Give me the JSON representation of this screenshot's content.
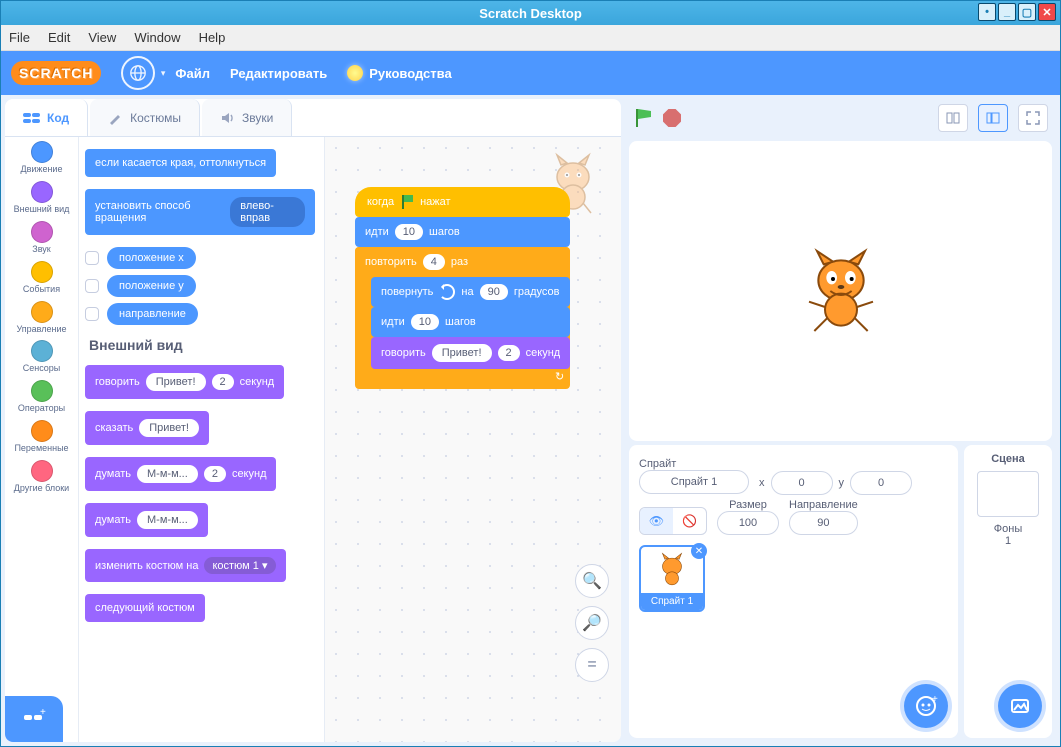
{
  "title": "Scratch Desktop",
  "menu": {
    "file": "File",
    "edit": "Edit",
    "view": "View",
    "window": "Window",
    "help": "Help"
  },
  "topbar": {
    "logo": "SCRATCH",
    "file": "Файл",
    "edit": "Редактировать",
    "tutorials": "Руководства"
  },
  "tabs": {
    "code": "Код",
    "costumes": "Костюмы",
    "sounds": "Звуки"
  },
  "categories": {
    "motion": "Движение",
    "looks": "Внешний вид",
    "sound": "Звук",
    "events": "События",
    "control": "Управление",
    "sensing": "Сенсоры",
    "operators": "Операторы",
    "variables": "Переменные",
    "myblocks": "Другие блоки"
  },
  "category_colors": {
    "motion": "#4c97ff",
    "looks": "#9966ff",
    "sound": "#cf63cf",
    "events": "#ffbf00",
    "control": "#ffab19",
    "sensing": "#5cb1d6",
    "operators": "#59c059",
    "variables": "#ff8c1a",
    "myblocks": "#ff6680"
  },
  "palette_motion": {
    "bounce": "если касается края, оттолкнуться",
    "set_rotation": "установить способ вращения",
    "rotation_value": "влево-вправ",
    "x_pos": "положение x",
    "y_pos": "положение y",
    "direction": "направление"
  },
  "palette_looks": {
    "header": "Внешний вид",
    "say_for": "говорить",
    "say_text": "Привет!",
    "say_secs": "2",
    "say_unit": "секунд",
    "say": "сказать",
    "say2_text": "Привет!",
    "think_for": "думать",
    "think_text": "М-м-м...",
    "think_secs": "2",
    "think_unit": "секунд",
    "think": "думать",
    "think2_text": "М-м-м...",
    "switch_costume": "изменить костюм на",
    "costume_val": "костюм 1 ▾",
    "next_costume": "следующий костюм"
  },
  "script": {
    "when_clicked_pre": "когда",
    "when_clicked_post": "нажат",
    "move1": "идти",
    "move1_val": "10",
    "move1_unit": "шагов",
    "repeat": "повторить",
    "repeat_val": "4",
    "repeat_unit": "раз",
    "turn": "повернуть",
    "turn_on": "на",
    "turn_val": "90",
    "turn_unit": "градусов",
    "move2": "идти",
    "move2_val": "10",
    "move2_unit": "шагов",
    "say": "говорить",
    "say_text": "Привет!",
    "say_secs": "2",
    "say_unit": "секунд"
  },
  "sprite_panel": {
    "sprite_lbl": "Спрайт",
    "sprite_name": "Спрайт 1",
    "x_lbl": "x",
    "x_val": "0",
    "y_lbl": "y",
    "y_val": "0",
    "size_lbl": "Размер",
    "size_val": "100",
    "dir_lbl": "Направление",
    "dir_val": "90",
    "thumb_caption": "Спрайт 1"
  },
  "scene_panel": {
    "title": "Сцена",
    "backdrops_lbl": "Фоны",
    "backdrops_count": "1"
  }
}
